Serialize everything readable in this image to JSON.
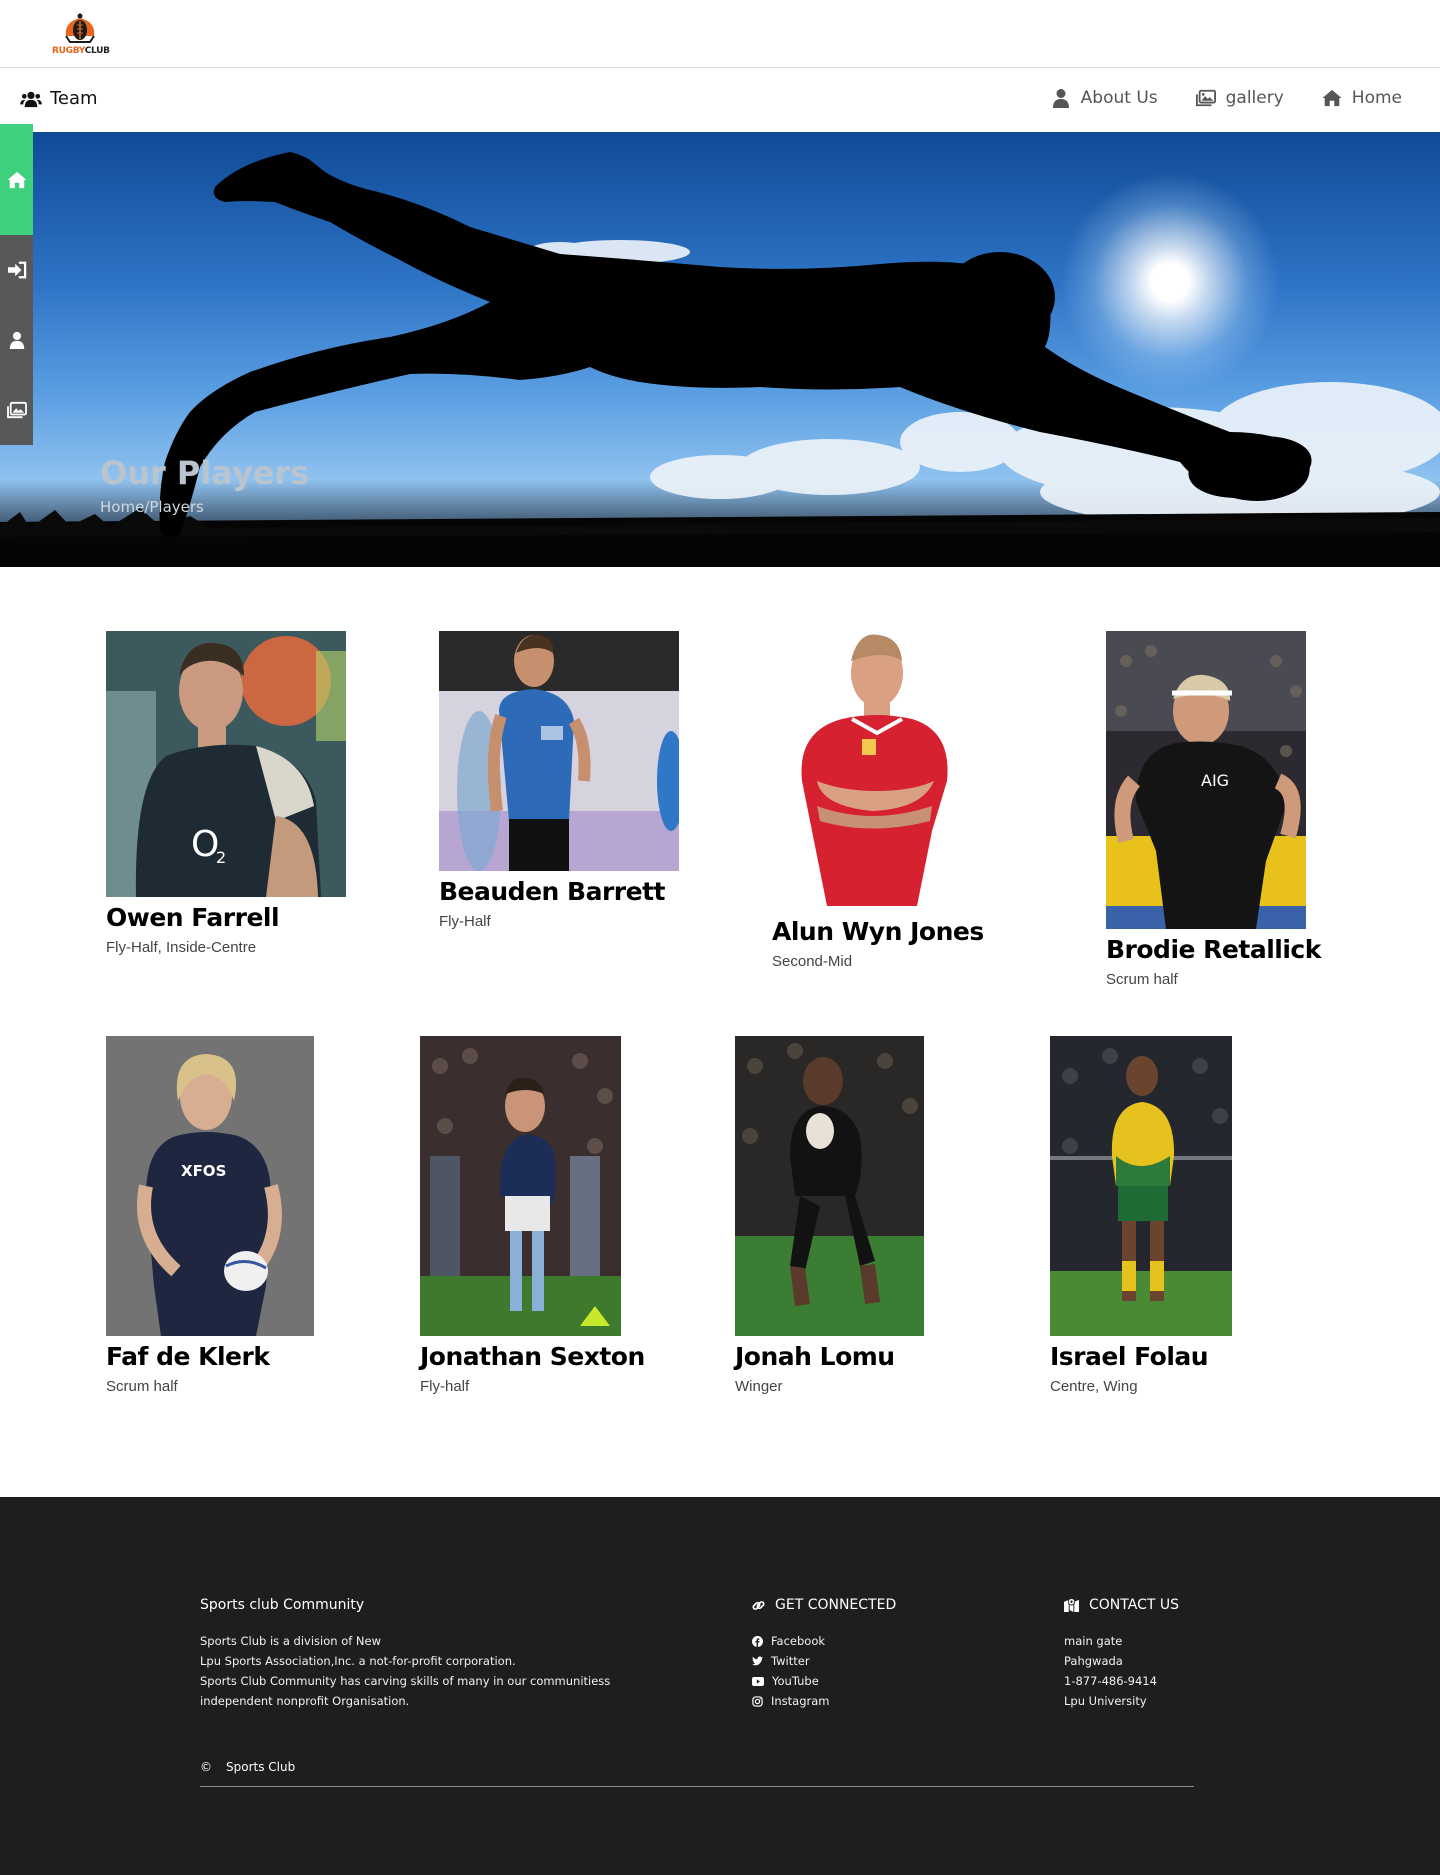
{
  "logo": {
    "text_a": "RUGBY",
    "text_b": "CLUB"
  },
  "nav": {
    "brand": {
      "label": "Team",
      "icon": "users-icon"
    },
    "items": [
      {
        "label": "About Us",
        "icon": "user-icon"
      },
      {
        "label": "gallery",
        "icon": "images-icon"
      },
      {
        "label": "Home",
        "icon": "home-icon"
      }
    ]
  },
  "sidebar": {
    "items": [
      {
        "icon": "home-icon",
        "active": true
      },
      {
        "icon": "sign-in-icon",
        "active": false
      },
      {
        "icon": "user-icon",
        "active": false
      },
      {
        "icon": "images-icon",
        "active": false
      }
    ],
    "colors": {
      "active": "#3fd07e",
      "bg": "#585858"
    }
  },
  "hero": {
    "title": "Our Players",
    "breadcrumb": "Home/Players"
  },
  "players": [
    {
      "name": "Owen Farrell",
      "position": "Fly-Half, Inside-Centre"
    },
    {
      "name": "Beauden Barrett",
      "position": "Fly-Half"
    },
    {
      "name": "Alun Wyn Jones",
      "position": "Second-Mid"
    },
    {
      "name": "Brodie Retallick",
      "position": "Scrum half"
    },
    {
      "name": "Faf de Klerk",
      "position": "Scrum half"
    },
    {
      "name": "Jonathan Sexton",
      "position": "Fly-half"
    },
    {
      "name": "Jonah Lomu",
      "position": "Winger"
    },
    {
      "name": "Israel Folau",
      "position": "Centre, Wing"
    }
  ],
  "footer": {
    "about": {
      "heading": "Sports club Community",
      "lines": [
        "Sports Club is a division of New",
        "Lpu Sports Association,Inc. a not-for-profit corporation.",
        "Sports Club Community has carving skills of many in our communitiess",
        "independent nonprofit Organisation."
      ]
    },
    "connect": {
      "heading": "GET CONNECTED",
      "links": [
        {
          "label": "Facebook",
          "icon": "facebook-icon"
        },
        {
          "label": "Twitter",
          "icon": "twitter-icon"
        },
        {
          "label": "YouTube",
          "icon": "youtube-icon"
        },
        {
          "label": "Instagram",
          "icon": "instagram-icon"
        }
      ]
    },
    "contact": {
      "heading": "CONTACT US",
      "lines": [
        "main gate",
        "Pahgwada",
        "1-877-486-9414",
        "Lpu University"
      ]
    },
    "copyright": {
      "symbol": "©",
      "text": "Sports Club"
    }
  }
}
